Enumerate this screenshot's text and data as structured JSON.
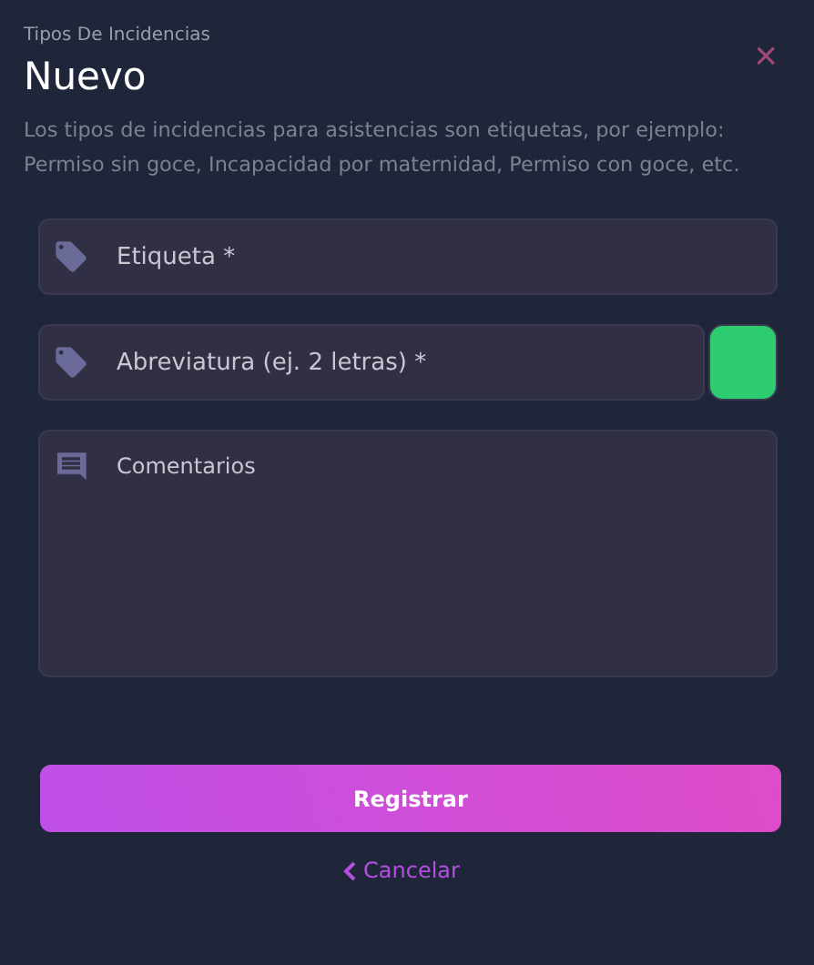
{
  "header": {
    "subtitle": "Tipos De Incidencias",
    "title": "Nuevo",
    "close": "×"
  },
  "description": "Los tipos de incidencias para asistencias son etiquetas, por ejemplo: Permiso sin goce, Incapacidad por maternidad, Permiso con goce, etc.",
  "fields": [
    {
      "kind": "text",
      "placeholder": "Etiqueta *"
    },
    {
      "kind": "text",
      "placeholder": "Abreviatura (ej. 2 letras) *",
      "color": "#2ecc71"
    },
    {
      "kind": "textarea",
      "placeholder": "Comentarios"
    }
  ],
  "submit": "Registrar",
  "cancel": "Cancelar"
}
